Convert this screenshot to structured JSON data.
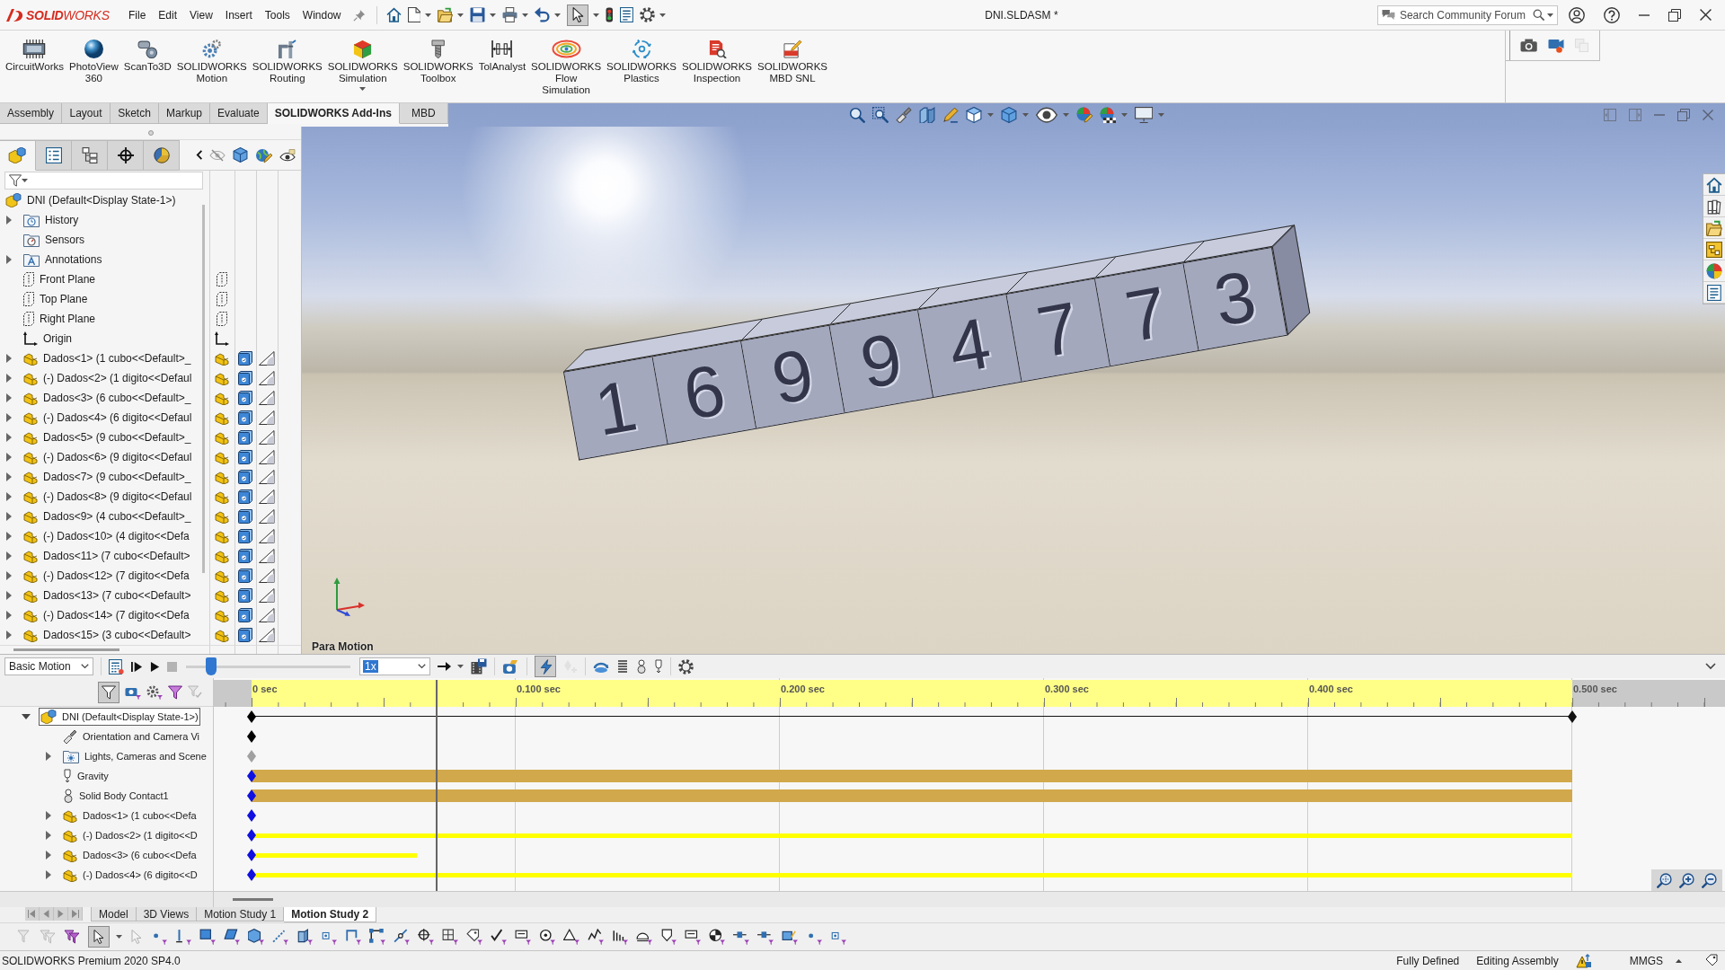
{
  "app": {
    "logo": "**SOLID**WORKS",
    "menu": [
      "File",
      "Edit",
      "View",
      "Insert",
      "Tools",
      "Window"
    ],
    "quick_access": {
      "select_pressed": true
    },
    "title": "DNI.SLDASM *",
    "search": {
      "placeholder": "Search Community Forum"
    }
  },
  "ribbon": {
    "commands": [
      {
        "label": "CircuitWorks",
        "dropdown": false
      },
      {
        "label": "PhotoView 360",
        "dropdown": false
      },
      {
        "label": "ScanTo3D",
        "dropdown": false
      },
      {
        "label": "SOLIDWORKS Motion",
        "dropdown": false
      },
      {
        "label": "SOLIDWORKS Routing",
        "dropdown": false
      },
      {
        "label": "SOLIDWORKS Simulation",
        "dropdown": true
      },
      {
        "label": "SOLIDWORKS Toolbox",
        "dropdown": false
      },
      {
        "label": "TolAnalyst",
        "dropdown": false
      },
      {
        "label": "SOLIDWORKS Flow Simulation",
        "dropdown": false
      },
      {
        "label": "SOLIDWORKS Plastics",
        "dropdown": false
      },
      {
        "label": "SOLIDWORKS Inspection",
        "dropdown": false
      },
      {
        "label": "SOLIDWORKS MBD SNL",
        "dropdown": false
      }
    ],
    "tabs": [
      {
        "label": "Assembly",
        "selected": false
      },
      {
        "label": "Layout",
        "selected": false
      },
      {
        "label": "Sketch",
        "selected": false
      },
      {
        "label": "Markup",
        "selected": false
      },
      {
        "label": "Evaluate",
        "selected": false
      },
      {
        "label": "SOLIDWORKS Add-Ins",
        "selected": true
      },
      {
        "label": "MBD",
        "selected": false
      }
    ]
  },
  "feature_manager": {
    "tabs": [
      {
        "selected": true
      },
      {
        "selected": false
      },
      {
        "selected": false
      },
      {
        "selected": false
      },
      {
        "selected": false
      }
    ],
    "tree": {
      "kind": "assembly",
      "label": "DNI (Default<Display State-1>)",
      "selected": false,
      "children": [
        {
          "kind": "history",
          "label": "History",
          "expanded": false,
          "selected": false
        },
        {
          "kind": "sensors",
          "label": "Sensors",
          "selected": false
        },
        {
          "kind": "annotations",
          "label": "Annotations",
          "expanded": false,
          "selected": false
        },
        {
          "kind": "plane",
          "label": "Front Plane",
          "selected": false
        },
        {
          "kind": "plane",
          "label": "Top Plane",
          "selected": false
        },
        {
          "kind": "plane",
          "label": "Right Plane",
          "selected": false
        },
        {
          "kind": "origin",
          "label": "Origin",
          "selected": false
        },
        {
          "kind": "component",
          "label": "Dados<1> (1 cubo<<Default>_",
          "expanded": false,
          "selected": false
        },
        {
          "kind": "component",
          "label": "(-) Dados<2> (1 digito<<Defaul",
          "expanded": false,
          "selected": false
        },
        {
          "kind": "component",
          "label": "Dados<3> (6 cubo<<Default>_",
          "expanded": false,
          "selected": false
        },
        {
          "kind": "component",
          "label": "(-) Dados<4> (6 digito<<Defaul",
          "expanded": false,
          "selected": false
        },
        {
          "kind": "component",
          "label": "Dados<5> (9 cubo<<Default>_",
          "expanded": false,
          "selected": false
        },
        {
          "kind": "component",
          "label": "(-) Dados<6> (9 digito<<Defaul",
          "expanded": false,
          "selected": false
        },
        {
          "kind": "component",
          "label": "Dados<7> (9 cubo<<Default>_",
          "expanded": false,
          "selected": false
        },
        {
          "kind": "component",
          "label": "(-) Dados<8> (9 digito<<Defaul",
          "expanded": false,
          "selected": false
        },
        {
          "kind": "component",
          "label": "Dados<9> (4 cubo<<Default>_",
          "expanded": false,
          "selected": false
        },
        {
          "kind": "component",
          "label": "(-) Dados<10> (4 digito<<Defa",
          "expanded": false,
          "selected": false
        },
        {
          "kind": "component",
          "label": "Dados<11> (7 cubo<<Default>",
          "expanded": false,
          "selected": false
        },
        {
          "kind": "component",
          "label": "(-) Dados<12> (7 digito<<Defa",
          "expanded": false,
          "selected": false
        },
        {
          "kind": "component",
          "label": "Dados<13> (7 cubo<<Default>",
          "expanded": false,
          "selected": false
        },
        {
          "kind": "component",
          "label": "(-) Dados<14> (7 digito<<Defa",
          "expanded": false,
          "selected": false
        },
        {
          "kind": "component",
          "label": "Dados<15> (3 cubo<<Default>",
          "expanded": false,
          "selected": false
        }
      ]
    }
  },
  "viewport": {
    "model_digits": [
      "1",
      "6",
      "9",
      "9",
      "4",
      "7",
      "7",
      "3"
    ],
    "caption": "Para Motion"
  },
  "motion_manager": {
    "study_type": "Basic Motion",
    "stop": {
      "disabled": true
    },
    "slider": {
      "level": 0.15
    },
    "playback_speed": "1x",
    "autokey": {
      "pressed": true
    },
    "add_key": {
      "disabled": true
    },
    "filter": {
      "pressed": true
    },
    "ruler": [
      "0 sec",
      "0.100 sec",
      "0.200 sec",
      "0.300 sec",
      "0.400 sec",
      "0.500 sec"
    ],
    "time_bar": {
      "level": 0.14
    },
    "tree": {
      "kind": "assembly",
      "label": "DNI (Default<Display State-1>)",
      "selected": true,
      "expanded": true,
      "key": {
        "color": "#000000"
      },
      "track": {
        "kind": "line",
        "level": 1
      },
      "children": [
        {
          "kind": "orientation",
          "label": "Orientation and Camera Vi",
          "selected": false,
          "key": {
            "color": "#000000"
          }
        },
        {
          "kind": "lights",
          "label": "Lights, Cameras and Scene",
          "selected": false,
          "expanded": false,
          "key": {
            "color": "#a0a0a0"
          }
        },
        {
          "kind": "gravity",
          "label": "Gravity",
          "selected": false,
          "key": {
            "color": "#1010e0"
          },
          "track": {
            "kind": "band",
            "level": 1
          }
        },
        {
          "kind": "contact",
          "label": "Solid Body Contact1",
          "selected": false,
          "key": {
            "color": "#1010e0"
          },
          "track": {
            "kind": "band",
            "level": 1
          }
        },
        {
          "kind": "component",
          "label": "Dados<1> (1 cubo<<Defa",
          "selected": false,
          "expanded": false,
          "key": {
            "color": "#1010e0"
          }
        },
        {
          "kind": "component",
          "label": "(-) Dados<2> (1 digito<<D",
          "selected": false,
          "expanded": false,
          "key": {
            "color": "#1010e0"
          },
          "track": {
            "kind": "stripe",
            "level": 1
          }
        },
        {
          "kind": "component",
          "label": "Dados<3> (6 cubo<<Defa",
          "selected": false,
          "expanded": false,
          "key": {
            "color": "#1010e0"
          },
          "track": {
            "kind": "stripe",
            "level": 0.125
          }
        },
        {
          "kind": "component",
          "label": "(-) Dados<4> (6 digito<<D",
          "selected": false,
          "expanded": false,
          "key": {
            "color": "#1010e0"
          },
          "track": {
            "kind": "stripe",
            "level": 1
          }
        }
      ]
    }
  },
  "study_tabs": [
    {
      "label": "Model",
      "selected": false
    },
    {
      "label": "3D Views",
      "selected": false
    },
    {
      "label": "Motion Study 1",
      "selected": false
    },
    {
      "label": "Motion Study 2",
      "selected": true
    }
  ],
  "selection_filter": {
    "select_pressed": true
  },
  "status_bar": {
    "version": "SOLIDWORKS Premium 2020 SP4.0",
    "definition": "Fully Defined",
    "mode": "Editing Assembly",
    "units": "MMGS"
  }
}
